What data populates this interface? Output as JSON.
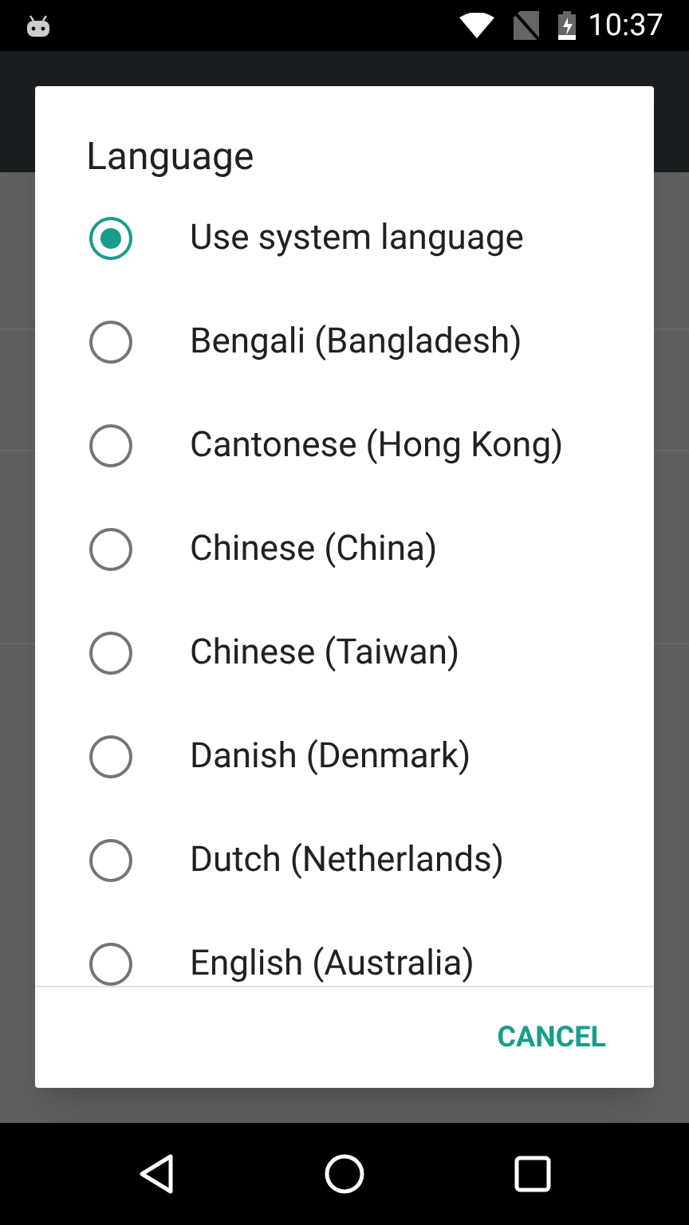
{
  "status_bar": {
    "time": "10:37"
  },
  "dialog": {
    "title": "Language",
    "options": [
      {
        "label": "Use system language",
        "selected": true
      },
      {
        "label": "Bengali (Bangladesh)",
        "selected": false
      },
      {
        "label": "Cantonese (Hong Kong)",
        "selected": false
      },
      {
        "label": "Chinese (China)",
        "selected": false
      },
      {
        "label": "Chinese (Taiwan)",
        "selected": false
      },
      {
        "label": "Danish (Denmark)",
        "selected": false
      },
      {
        "label": "Dutch (Netherlands)",
        "selected": false
      },
      {
        "label": "English (Australia)",
        "selected": false
      }
    ],
    "buttons": [
      "CANCEL"
    ]
  }
}
